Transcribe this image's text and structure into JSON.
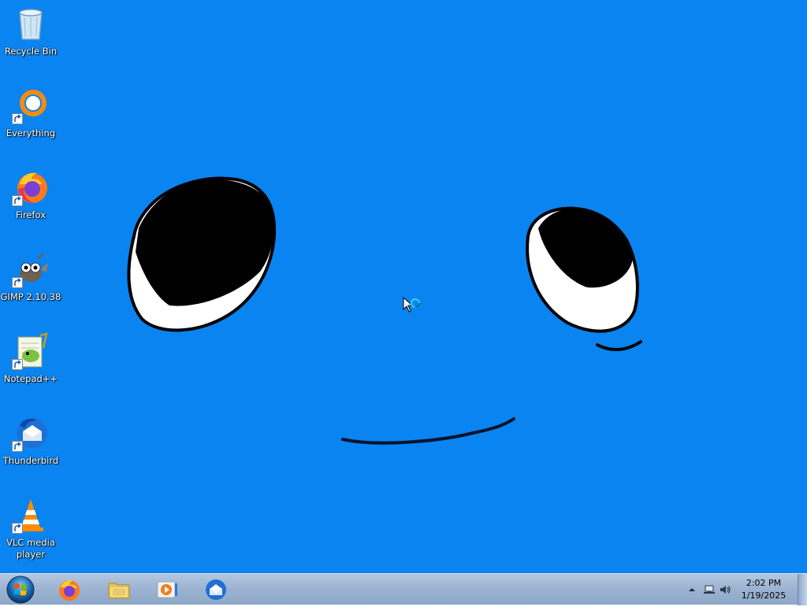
{
  "desktop": {
    "background_color": "#0a84f0",
    "icons": [
      {
        "label": "Recycle Bin",
        "icon": "recycle-bin-icon",
        "shortcut": false
      },
      {
        "label": "Everything",
        "icon": "everything-icon",
        "shortcut": true
      },
      {
        "label": "Firefox",
        "icon": "firefox-icon",
        "shortcut": true
      },
      {
        "label": "GIMP 2.10.38",
        "icon": "gimp-icon",
        "shortcut": true
      },
      {
        "label": "Notepad++",
        "icon": "notepad-plus-plus-icon",
        "shortcut": true
      },
      {
        "label": "Thunderbird",
        "icon": "thunderbird-icon",
        "shortcut": true
      },
      {
        "label": "VLC media\nplayer",
        "icon": "vlc-icon",
        "shortcut": true
      }
    ]
  },
  "taskbar": {
    "start_icon": "windows-orb-icon",
    "pinned": [
      {
        "name": "Firefox",
        "icon": "firefox-icon"
      },
      {
        "name": "Windows Explorer",
        "icon": "folder-icon"
      },
      {
        "name": "Windows Media Player",
        "icon": "media-player-icon"
      },
      {
        "name": "Thunderbird",
        "icon": "thunderbird-icon"
      }
    ],
    "tray": {
      "icons": [
        "chevron-up-icon",
        "network-icon",
        "volume-icon"
      ],
      "time": "2:02 PM",
      "date": "1/19/2025"
    }
  }
}
